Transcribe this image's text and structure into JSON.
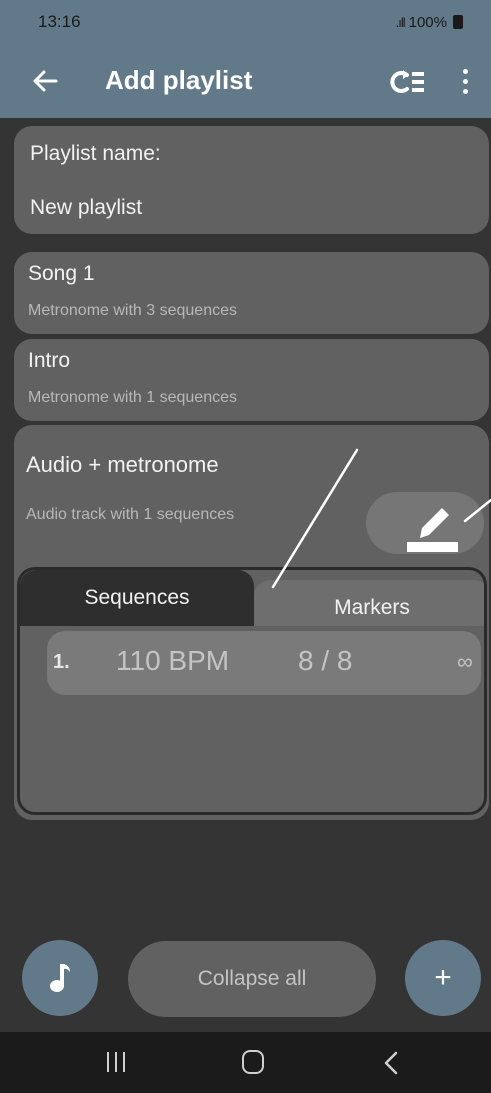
{
  "status_bar": {
    "time": "13:16",
    "signal": ".ıll",
    "battery": "100%"
  },
  "app_bar": {
    "title": "Add playlist",
    "back_icon": "arrow-left-icon",
    "convert_icon": "convert-list-icon",
    "menu_icon": "more-vertical-icon"
  },
  "playlist_name": {
    "label": "Playlist name:",
    "value": "New playlist"
  },
  "songs": [
    {
      "title": "Song 1",
      "subtitle": "Metronome with 3 sequences"
    },
    {
      "title": "Intro",
      "subtitle": "Metronome with 1 sequences"
    }
  ],
  "expanded_song": {
    "title": "Audio + metronome",
    "subtitle": "Audio track with 1 sequences",
    "edit_icon": "pencil-icon",
    "tabs": [
      {
        "label": "Sequences",
        "selected": true
      },
      {
        "label": "Markers",
        "selected": false
      }
    ],
    "sequences": [
      {
        "index": "1.",
        "bpm": "110 BPM",
        "time_signature": "8 / 8",
        "repeat": "∞"
      }
    ]
  },
  "bottom_actions": {
    "note_icon": "music-note-icon",
    "collapse_label": "Collapse all",
    "add_label": "+"
  },
  "nav_bar": {
    "recent_icon": "recent-apps-icon",
    "home_icon": "home-icon",
    "back_icon": "back-chevron-icon"
  },
  "colors": {
    "app_bar": "#617989",
    "background": "#343434",
    "card": "#616161",
    "tab_selected": "#2e2e2e",
    "nav_bar": "#1b1b1b"
  }
}
